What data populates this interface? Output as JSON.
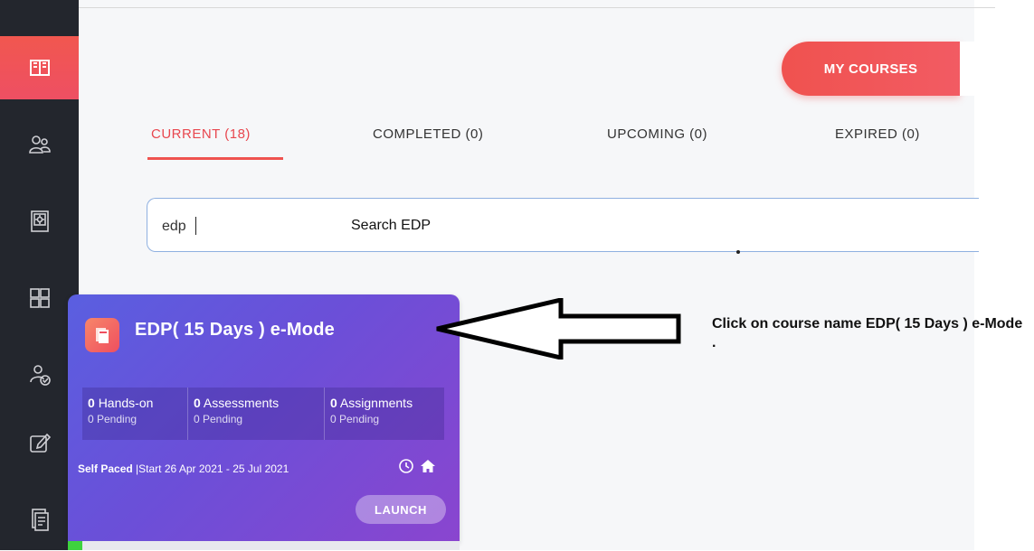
{
  "header": {
    "my_courses_label": "MY COURSES"
  },
  "tabs": [
    {
      "label": "CURRENT (18)"
    },
    {
      "label": "COMPLETED (0)"
    },
    {
      "label": "UPCOMING (0)"
    },
    {
      "label": "EXPIRED (0)"
    }
  ],
  "search": {
    "value": "edp",
    "note": "Search  EDP"
  },
  "course": {
    "title": "EDP( 15 Days ) e-Mode",
    "stats": [
      {
        "count": "0",
        "label": "Hands-on",
        "pending": "0 Pending"
      },
      {
        "count": "0",
        "label": "Assessments",
        "pending": "0 Pending"
      },
      {
        "count": "0",
        "label": "Assignments",
        "pending": "0 Pending"
      }
    ],
    "pace": "Self Paced",
    "dates": "Start 26 Apr 2021 - 25 Jul 2021",
    "launch_label": "LAUNCH",
    "progress_fraction": 0.04
  },
  "annotation": {
    "text": "Click on course name EDP( 15 Days ) e-Mode ."
  },
  "colors": {
    "accent": "#ef5350",
    "sidebar": "#23262d",
    "card_start": "#5a5fe0",
    "card_end": "#8a45cf"
  },
  "sidebar": {
    "icons": [
      "book-icon",
      "users-icon",
      "settings-book-icon",
      "puzzle-icon",
      "user-check-icon",
      "edit-icon",
      "document-icon"
    ]
  }
}
